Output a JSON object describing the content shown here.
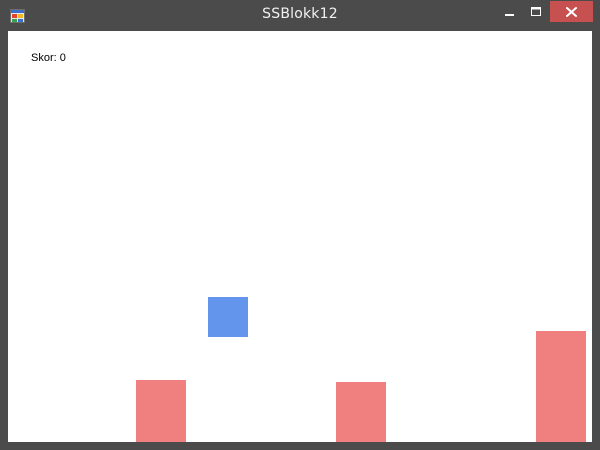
{
  "window": {
    "title": "SSBlokk12",
    "icon": "app-form-icon",
    "controls": {
      "minimize_icon": "minimize-icon",
      "maximize_icon": "maximize-icon",
      "close_icon": "close-icon"
    },
    "colors": {
      "chrome": "#4b4b4b",
      "close_button": "#c75050"
    }
  },
  "game": {
    "score_label": "Skor: 0",
    "player_color": "#6495ed",
    "obstacle_color": "#f08080"
  }
}
